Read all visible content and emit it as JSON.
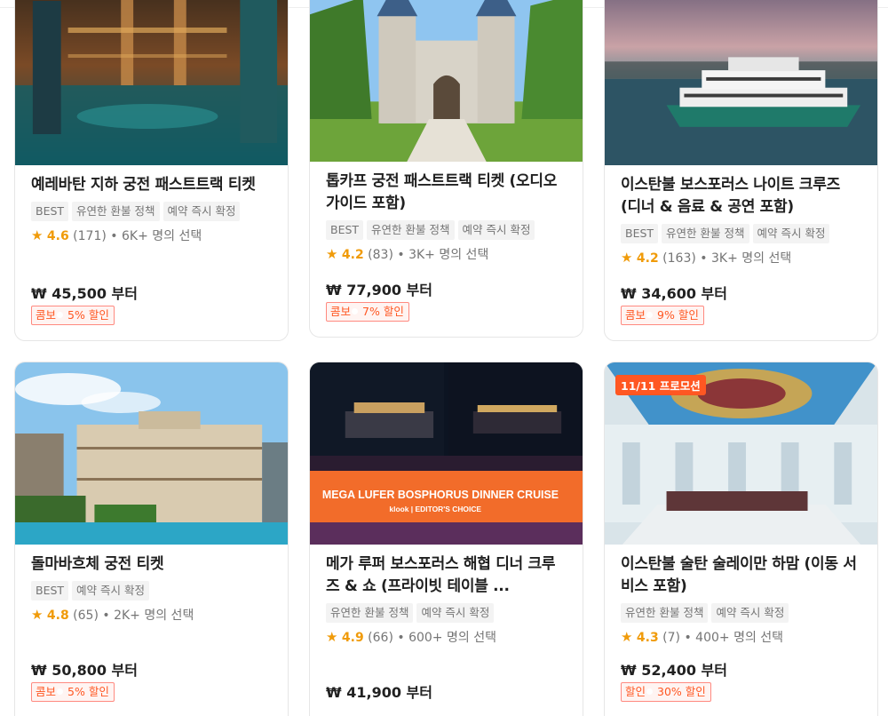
{
  "cards": [
    {
      "title": "예레바탄 지하 궁전 패스트트랙 티켓",
      "tags": [
        "BEST",
        "유연한 환불 정책",
        "예약 즉시 확정"
      ],
      "rating": "4.6",
      "reviews": "(171)",
      "booked": "• 6K+ 명의 선택",
      "price": "₩ 45,500 부터",
      "promo_type": "콤보",
      "promo_text": "5% 할인"
    },
    {
      "title": "톱카프 궁전 패스트트랙 티켓 (오디오 가이드 포함)",
      "tags": [
        "BEST",
        "유연한 환불 정책",
        "예약 즉시 확정"
      ],
      "rating": "4.2",
      "reviews": "(83)",
      "booked": "• 3K+ 명의 선택",
      "price": "₩ 77,900 부터",
      "promo_type": "콤보",
      "promo_text": "7% 할인"
    },
    {
      "title": "이스탄불 보스포러스 나이트 크루즈 (디너 & 음료 & 공연 포함)",
      "tags": [
        "BEST",
        "유연한 환불 정책",
        "예약 즉시 확정"
      ],
      "rating": "4.2",
      "reviews": "(163)",
      "booked": "• 3K+ 명의 선택",
      "price": "₩ 34,600 부터",
      "promo_type": "콤보",
      "promo_text": "9% 할인"
    },
    {
      "title": "돌마바흐체 궁전 티켓",
      "tags": [
        "BEST",
        "예약 즉시 확정"
      ],
      "rating": "4.8",
      "reviews": "(65)",
      "booked": "• 2K+ 명의 선택",
      "price": "₩ 50,800 부터",
      "promo_type": "콤보",
      "promo_text": "5% 할인"
    },
    {
      "title": "메가 루퍼 보스포러스 해협 디너 크루즈 & 쇼 (프라이빗 테이블 ...",
      "tags": [
        "유연한 환불 정책",
        "예약 즉시 확정"
      ],
      "rating": "4.9",
      "reviews": "(66)",
      "booked": "• 600+ 명의 선택",
      "price": "₩ 41,900 부터",
      "image_text_1": "MEGA LUFER BOSPHORUS DINNER CRUISE",
      "image_text_2": "klook | EDITOR'S CHOICE"
    },
    {
      "title": "이스탄불 술탄 술레이만 하맘 (이동 서비스 포함)",
      "tags": [
        "유연한 환불 정책",
        "예약 즉시 확정"
      ],
      "rating": "4.3",
      "reviews": "(7)",
      "booked": "• 400+ 명의 선택",
      "price": "₩ 52,400 부터",
      "promo_type": "할인",
      "promo_text": "30% 할인",
      "badge": "11/11 프로모션"
    }
  ],
  "star_glyph": "★"
}
